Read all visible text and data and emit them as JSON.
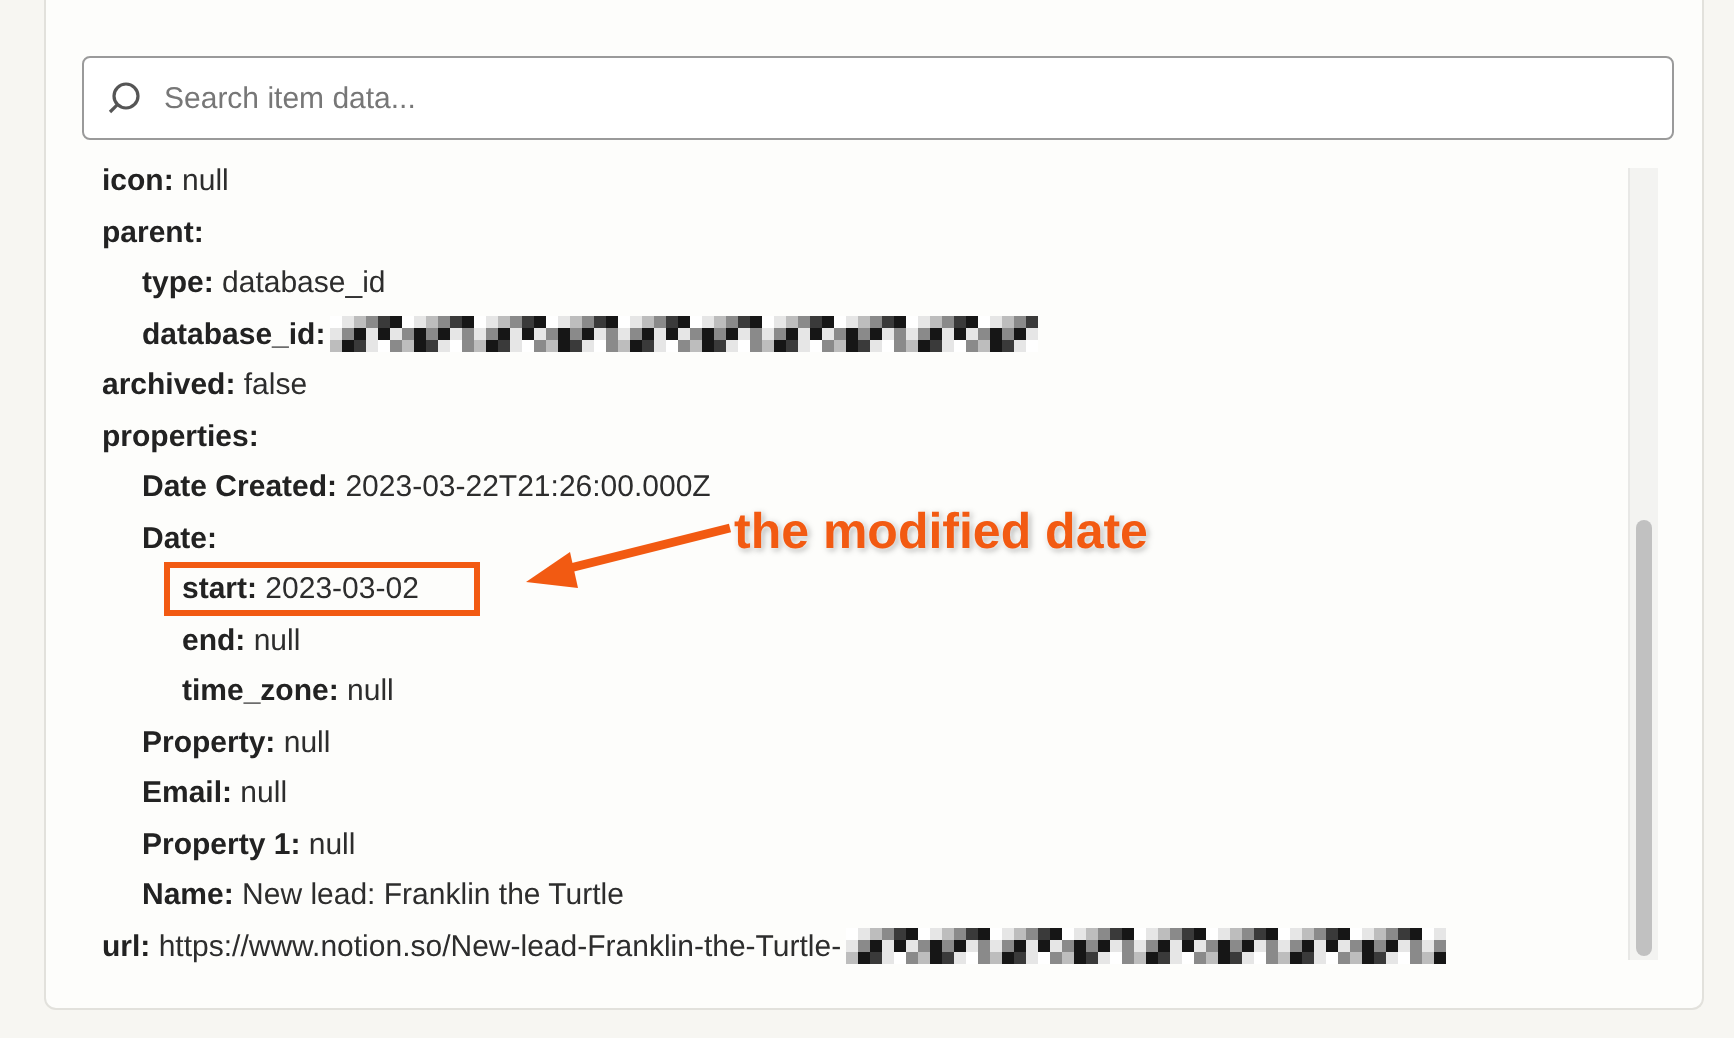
{
  "search": {
    "placeholder": "Search item data..."
  },
  "fields": [
    {
      "key": "icon:",
      "value": "null",
      "highlighted": false
    },
    {
      "key": "parent:",
      "highlighted": false,
      "children": [
        {
          "key": "type:",
          "value": "database_id",
          "highlighted": false
        },
        {
          "key": "database_id:",
          "redacted": true,
          "highlighted": false
        }
      ]
    },
    {
      "key": "archived:",
      "value": "false",
      "highlighted": false
    },
    {
      "key": "properties:",
      "highlighted": false,
      "children": [
        {
          "key": "Date Created:",
          "value": "2023-03-22T21:26:00.000Z",
          "highlighted": false
        },
        {
          "key": "Date:",
          "highlighted": false,
          "children": [
            {
              "key": "start:",
              "value": "2023-03-02",
              "highlighted": true
            },
            {
              "key": "end:",
              "value": "null",
              "highlighted": false
            },
            {
              "key": "time_zone:",
              "value": "null",
              "highlighted": false
            }
          ]
        },
        {
          "key": "Property:",
          "value": "null",
          "highlighted": false
        },
        {
          "key": "Email:",
          "value": "null",
          "highlighted": false
        },
        {
          "key": "Property 1:",
          "value": "null",
          "highlighted": false
        },
        {
          "key": "Name:",
          "value": "New lead: Franklin the Turtle",
          "highlighted": false
        }
      ]
    },
    {
      "key": "url:",
      "value": "https://www.notion.so/New-lead-Franklin-the-Turtle-",
      "redacted": true,
      "highlighted": false
    }
  ],
  "annotation": {
    "text": "the modified date"
  }
}
